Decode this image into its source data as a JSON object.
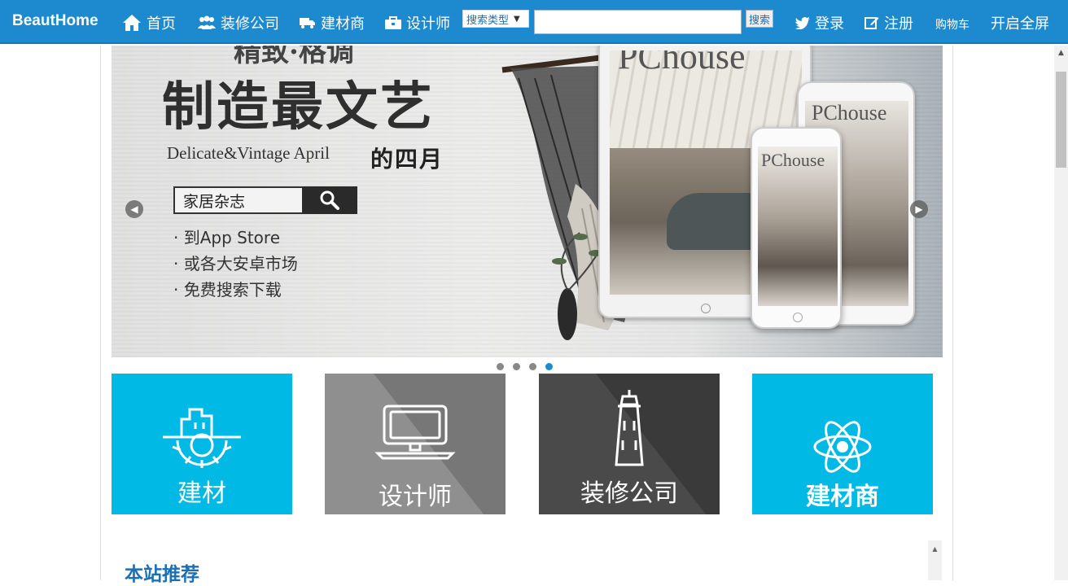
{
  "navbar": {
    "brand": "BeautHome",
    "items": [
      {
        "label": "首页",
        "icon": "home-icon"
      },
      {
        "label": "装修公司",
        "icon": "users-icon"
      },
      {
        "label": "建材商",
        "icon": "truck-icon"
      },
      {
        "label": "设计师",
        "icon": "briefcase-icon"
      }
    ],
    "search_type": "搜索类型",
    "search_value": "",
    "search_button": "搜索",
    "login": "登录",
    "register": "注册",
    "cart": "购物车",
    "fullscreen": "开启全屏",
    "colors": {
      "bar": "#1d89cf",
      "text": "#ffffff"
    }
  },
  "banner": {
    "top_text": "精致·格调",
    "headline": "制造最文艺",
    "subtitle_en": "Delicate&Vintage April",
    "subtitle_cn": "的四月",
    "search_text": "家居杂志",
    "lines": [
      "· 到App Store",
      "· 或各大安卓市场",
      "· 免费搜索下载"
    ],
    "slides_total": 4,
    "active_slide": 4,
    "magazine_title": "PChouse"
  },
  "tiles": [
    {
      "label": "建材",
      "icon": "building-gear-icon",
      "color": "#00b9e4"
    },
    {
      "label": "设计师",
      "icon": "monitor-icon",
      "color": "#8f8f8f"
    },
    {
      "label": "装修公司",
      "icon": "lighthouse-icon",
      "color": "#4a4a4a"
    },
    {
      "label": "建材商",
      "icon": "atom-icon",
      "color": "#00b9e4"
    }
  ],
  "section": {
    "title": "本站推荐"
  }
}
